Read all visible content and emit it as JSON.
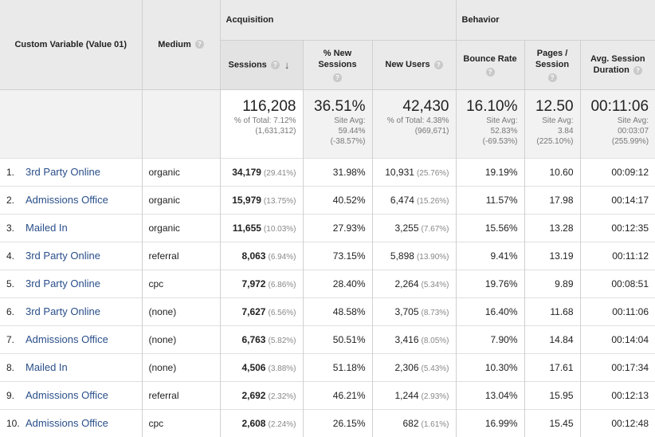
{
  "headers": {
    "custom_variable": "Custom Variable (Value 01)",
    "medium": "Medium",
    "acquisition": "Acquisition",
    "behavior": "Behavior",
    "sessions": "Sessions",
    "pct_new_sessions": "% New Sessions",
    "new_users": "New Users",
    "bounce_rate": "Bounce Rate",
    "pages_session": "Pages / Session",
    "avg_session_duration": "Avg. Session Duration",
    "help_glyph": "?"
  },
  "totals": {
    "sessions": {
      "value": "116,208",
      "line1": "% of Total: 7.12%",
      "line2": "(1,631,312)",
      "line3": ""
    },
    "pct_new_sessions": {
      "value": "36.51%",
      "line1": "Site Avg:",
      "line2": "59.44%",
      "line3": "(-38.57%)"
    },
    "new_users": {
      "value": "42,430",
      "line1": "% of Total: 4.38%",
      "line2": "(969,671)",
      "line3": ""
    },
    "bounce_rate": {
      "value": "16.10%",
      "line1": "Site Avg:",
      "line2": "52.83%",
      "line3": "(-69.53%)"
    },
    "pages_session": {
      "value": "12.50",
      "line1": "Site Avg:",
      "line2": "3.84",
      "line3": "(225.10%)"
    },
    "avg_session_duration": {
      "value": "00:11:06",
      "line1": "Site Avg:",
      "line2": "00:03:07",
      "line3": "(255.99%)"
    }
  },
  "rows": [
    {
      "index": "1.",
      "name": "3rd Party Online",
      "medium": "organic",
      "sessions": "34,179",
      "sessions_pct": "(29.41%)",
      "pct_new": "31.98%",
      "new_users": "10,931",
      "new_users_pct": "(25.76%)",
      "bounce": "19.19%",
      "pages": "10.60",
      "duration": "00:09:12"
    },
    {
      "index": "2.",
      "name": "Admissions Office",
      "medium": "organic",
      "sessions": "15,979",
      "sessions_pct": "(13.75%)",
      "pct_new": "40.52%",
      "new_users": "6,474",
      "new_users_pct": "(15.26%)",
      "bounce": "11.57%",
      "pages": "17.98",
      "duration": "00:14:17"
    },
    {
      "index": "3.",
      "name": "Mailed In",
      "medium": "organic",
      "sessions": "11,655",
      "sessions_pct": "(10.03%)",
      "pct_new": "27.93%",
      "new_users": "3,255",
      "new_users_pct": "(7.67%)",
      "bounce": "15.56%",
      "pages": "13.28",
      "duration": "00:12:35"
    },
    {
      "index": "4.",
      "name": "3rd Party Online",
      "medium": "referral",
      "sessions": "8,063",
      "sessions_pct": "(6.94%)",
      "pct_new": "73.15%",
      "new_users": "5,898",
      "new_users_pct": "(13.90%)",
      "bounce": "9.41%",
      "pages": "13.19",
      "duration": "00:11:12"
    },
    {
      "index": "5.",
      "name": "3rd Party Online",
      "medium": "cpc",
      "sessions": "7,972",
      "sessions_pct": "(6.86%)",
      "pct_new": "28.40%",
      "new_users": "2,264",
      "new_users_pct": "(5.34%)",
      "bounce": "19.76%",
      "pages": "9.89",
      "duration": "00:08:51"
    },
    {
      "index": "6.",
      "name": "3rd Party Online",
      "medium": "(none)",
      "sessions": "7,627",
      "sessions_pct": "(6.56%)",
      "pct_new": "48.58%",
      "new_users": "3,705",
      "new_users_pct": "(8.73%)",
      "bounce": "16.40%",
      "pages": "11.68",
      "duration": "00:11:06"
    },
    {
      "index": "7.",
      "name": "Admissions Office",
      "medium": "(none)",
      "sessions": "6,763",
      "sessions_pct": "(5.82%)",
      "pct_new": "50.51%",
      "new_users": "3,416",
      "new_users_pct": "(8.05%)",
      "bounce": "7.90%",
      "pages": "14.84",
      "duration": "00:14:04"
    },
    {
      "index": "8.",
      "name": "Mailed In",
      "medium": "(none)",
      "sessions": "4,506",
      "sessions_pct": "(3.88%)",
      "pct_new": "51.18%",
      "new_users": "2,306",
      "new_users_pct": "(5.43%)",
      "bounce": "10.30%",
      "pages": "17.61",
      "duration": "00:17:34"
    },
    {
      "index": "9.",
      "name": "Admissions Office",
      "medium": "referral",
      "sessions": "2,692",
      "sessions_pct": "(2.32%)",
      "pct_new": "46.21%",
      "new_users": "1,244",
      "new_users_pct": "(2.93%)",
      "bounce": "13.04%",
      "pages": "15.95",
      "duration": "00:12:13"
    },
    {
      "index": "10.",
      "name": "Admissions Office",
      "medium": "cpc",
      "sessions": "2,608",
      "sessions_pct": "(2.24%)",
      "pct_new": "26.15%",
      "new_users": "682",
      "new_users_pct": "(1.61%)",
      "bounce": "16.99%",
      "pages": "15.45",
      "duration": "00:12:48"
    }
  ]
}
